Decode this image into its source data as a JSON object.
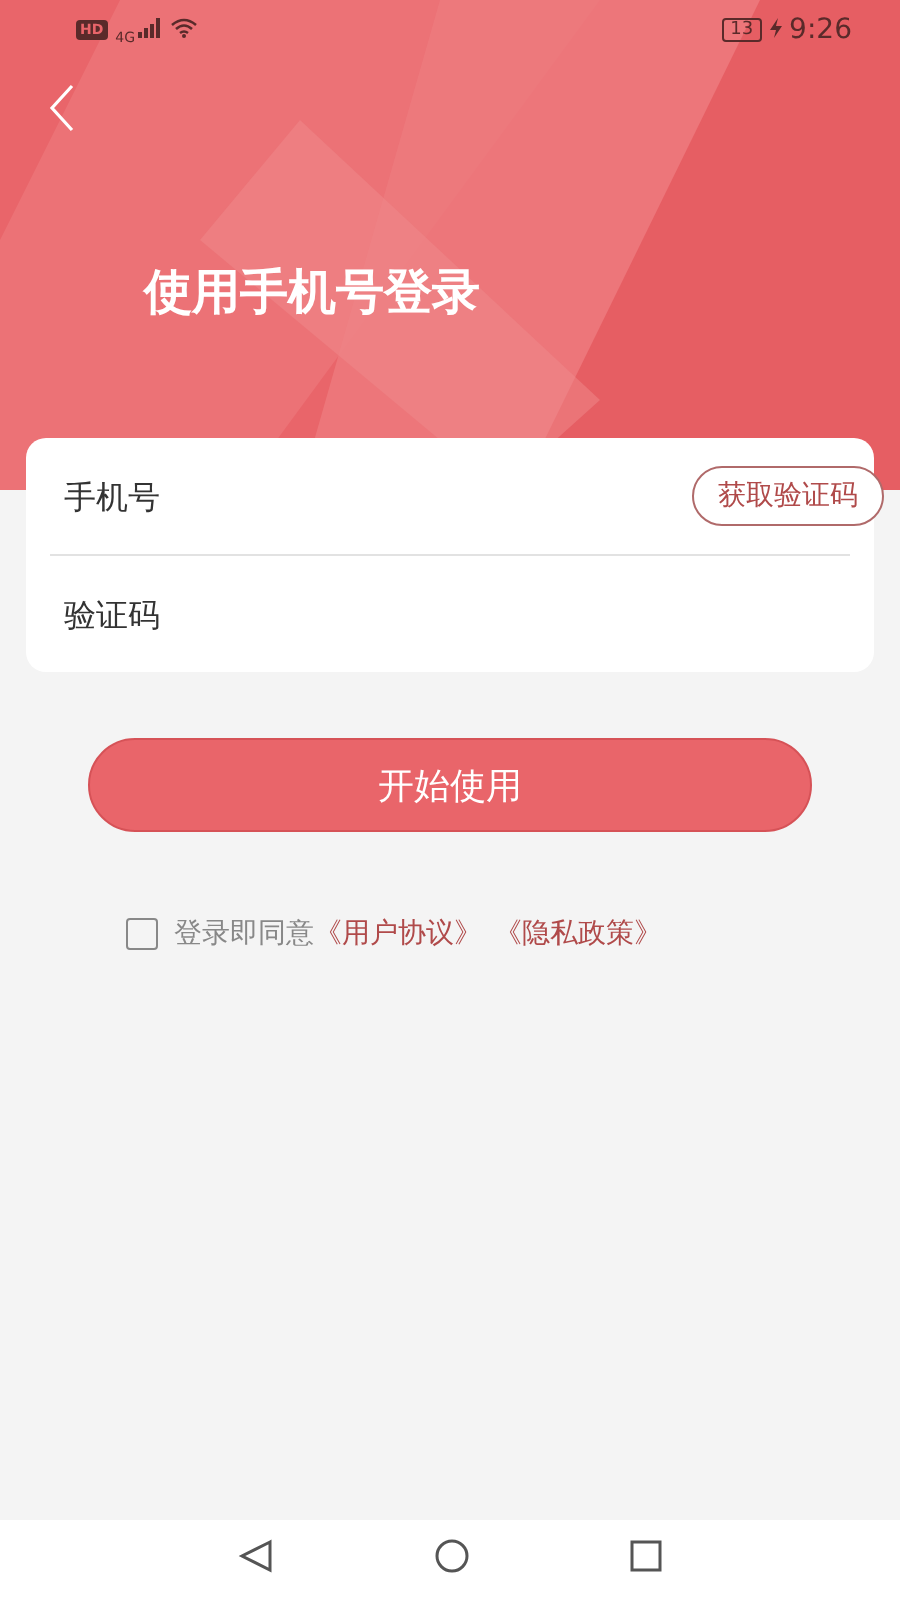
{
  "status_bar": {
    "hd": "HD",
    "network": "4G",
    "battery": "13",
    "time": "9:26"
  },
  "header": {
    "title": "使用手机号登录"
  },
  "form": {
    "fields": [
      {
        "placeholder": "手机号",
        "kind": "phone"
      },
      {
        "placeholder": "验证码",
        "kind": "code"
      }
    ],
    "code_button": "获取验证码"
  },
  "submit_button": "开始使用",
  "agreement": {
    "checked": false,
    "text": "登录即同意",
    "links": [
      "《用户协议》",
      "《隐私政策》"
    ]
  }
}
